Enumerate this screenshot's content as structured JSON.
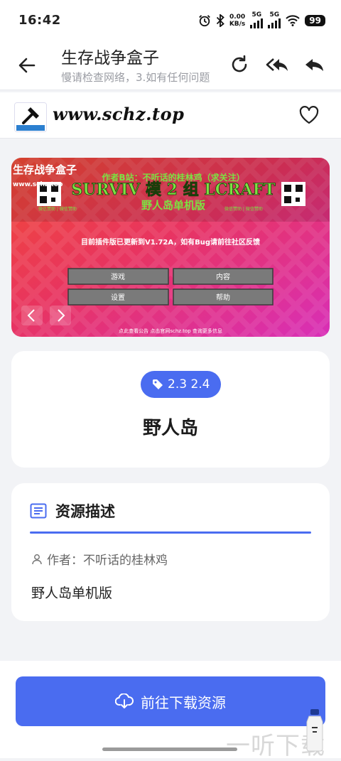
{
  "status": {
    "time": "16:42",
    "net_speed_top": "0.00",
    "net_speed_bottom": "KB/s",
    "sim1": "5G",
    "sim2": "5G",
    "battery": "99"
  },
  "toolbar": {
    "title": "生存战争盒子",
    "subtitle": "慢请检查网络，3.如有任何问题",
    "icons": [
      "back-arrow-icon",
      "refresh-icon",
      "reply-all-icon",
      "reply-icon"
    ]
  },
  "site": {
    "url": "www.schz.top",
    "logo_text": "生存战争盒子"
  },
  "banner": {
    "title": "生存战争盒子",
    "site": "www.schz.top",
    "author_line": "作者B站：不听话的桂林鸡（求关注）",
    "big_title": "SURVIV 模 2 组 LCRAFT",
    "subtitle": "野人岛单机版",
    "left_tag": "微信赞助 | 微信赞助",
    "right_tag": "微信赞助 | 微信赞助",
    "notice": "目前插件版已更新到V1.72A，如有Bug请前往社区反馈",
    "buttons": [
      "游戏",
      "内容",
      "设置",
      "帮助"
    ],
    "footer": "点此查看公告   点击官网schz.top   查询更多信息",
    "colors": {
      "accent_green": "#7de042"
    }
  },
  "info_card": {
    "tag": "2.3 2.4",
    "title": "野人岛"
  },
  "desc_card": {
    "heading": "资源描述",
    "author": "作者：不听话的桂林鸡",
    "description": "野人岛单机版"
  },
  "download": {
    "label": "前往下载资源"
  },
  "watermark": "一听下载",
  "colors": {
    "primary": "#4a6cf0",
    "background": "#f2f3f6",
    "card": "#ffffff"
  }
}
